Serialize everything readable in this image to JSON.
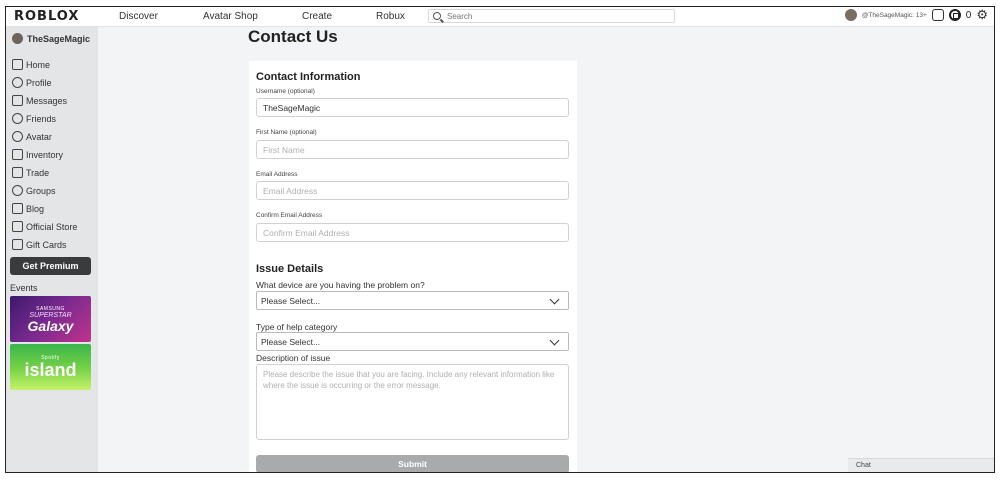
{
  "brand": {
    "logo_text": "ROBLOX"
  },
  "nav": {
    "links": [
      "Discover",
      "Avatar Shop",
      "Create",
      "Robux"
    ],
    "search_placeholder": "Search"
  },
  "topbar_right": {
    "username": "@TheSageMagic: 13+",
    "robux": "0"
  },
  "sidebar": {
    "user": "TheSageMagic",
    "items": [
      {
        "label": "Home",
        "icon": "home-icon"
      },
      {
        "label": "Profile",
        "icon": "profile-icon"
      },
      {
        "label": "Messages",
        "icon": "messages-icon"
      },
      {
        "label": "Friends",
        "icon": "friends-icon"
      },
      {
        "label": "Avatar",
        "icon": "avatar-icon"
      },
      {
        "label": "Inventory",
        "icon": "inventory-icon"
      },
      {
        "label": "Trade",
        "icon": "trade-icon"
      },
      {
        "label": "Groups",
        "icon": "groups-icon"
      },
      {
        "label": "Blog",
        "icon": "blog-icon"
      },
      {
        "label": "Official Store",
        "icon": "store-icon"
      },
      {
        "label": "Gift Cards",
        "icon": "gift-card-icon"
      }
    ],
    "premium_label": "Get Premium",
    "events_label": "Events",
    "events": [
      {
        "line1": "SAMSUNG",
        "line2": "SUPERSTAR",
        "line3": "Galaxy"
      },
      {
        "line1": "Spotify",
        "line2": "island"
      }
    ]
  },
  "main": {
    "page_title": "Contact Us",
    "contact": {
      "title": "Contact Information",
      "username_label": "Username (optional)",
      "username_value": "TheSageMagic",
      "first_name_label": "First Name (optional)",
      "first_name_placeholder": "First Name",
      "email_label": "Email Address",
      "email_placeholder": "Email Address",
      "confirm_email_label": "Confirm Email Address",
      "confirm_email_placeholder": "Confirm Email Address"
    },
    "issue": {
      "title": "Issue Details",
      "device_question": "What device are you having the problem on?",
      "device_value": "Please Select...",
      "category_question": "Type of help category",
      "category_value": "Please Select...",
      "description_label": "Description of issue",
      "description_placeholder": "Please describe the issue that you are facing. Include any relevant information like where the issue is occurring or the error message."
    },
    "submit_label": "Submit"
  },
  "chat": {
    "label": "Chat"
  }
}
